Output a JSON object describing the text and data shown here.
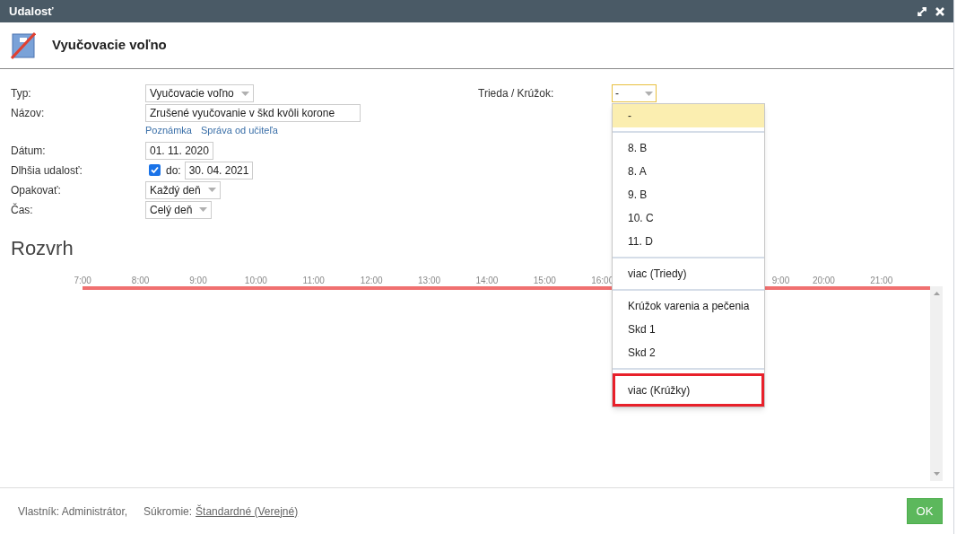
{
  "window": {
    "title": "Udalosť"
  },
  "header": {
    "title": "Vyučovacie voľno"
  },
  "form": {
    "fields": [
      {
        "kind": "select",
        "label": "Typ:",
        "value": "Vyučovacie voľno"
      },
      {
        "kind": "text",
        "label": "Názov:",
        "value": "Zrušené vyučovanie v škd kvôli korone",
        "links": [
          "Poznámka",
          "Správa od učiteľa"
        ]
      },
      {
        "kind": "text",
        "label": "Dátum:",
        "value": "01. 11. 2020"
      },
      {
        "kind": "checkdate",
        "label": "Dlhšia udalosť:",
        "checked": true,
        "to_label": "do:",
        "value": "30. 04. 2021"
      },
      {
        "kind": "select",
        "label": "Opakovať:",
        "value": "Každý deň"
      },
      {
        "kind": "select",
        "label": "Čas:",
        "value": "Celý deň"
      }
    ],
    "class_select": {
      "label": "Trieda / Krúžok:",
      "value": "-",
      "open": true
    }
  },
  "dropdown": {
    "groups": [
      [
        {
          "label": "-",
          "selected": true,
          "highlighted": false
        }
      ],
      [
        {
          "label": "8. B",
          "selected": false,
          "highlighted": false
        },
        {
          "label": "8. A",
          "selected": false,
          "highlighted": false
        },
        {
          "label": "9. B",
          "selected": false,
          "highlighted": false
        },
        {
          "label": "10. C",
          "selected": false,
          "highlighted": false
        },
        {
          "label": "11. D",
          "selected": false,
          "highlighted": false
        }
      ],
      [
        {
          "label": "viac (Triedy)",
          "selected": false,
          "highlighted": false
        }
      ],
      [
        {
          "label": "Krúžok varenia a pečenia",
          "selected": false,
          "highlighted": false
        },
        {
          "label": "Skd 1",
          "selected": false,
          "highlighted": false
        },
        {
          "label": "Skd 2",
          "selected": false,
          "highlighted": false
        }
      ],
      [
        {
          "label": "viac (Krúžky)",
          "selected": false,
          "highlighted": true
        }
      ]
    ]
  },
  "schedule": {
    "title": "Rozvrh",
    "hours_left": [
      "7:00",
      "8:00",
      "9:00",
      "10:00",
      "11:00",
      "12:00",
      "13:00",
      "14:00",
      "15:00",
      "16:00"
    ],
    "hours_right": [
      "9:00",
      "20:00",
      "21:00"
    ]
  },
  "footer": {
    "owner": "Vlastník: Administrátor,",
    "privacy_label": "Súkromie:",
    "privacy_value": "Štandardné (Verejné)",
    "ok": "OK"
  }
}
